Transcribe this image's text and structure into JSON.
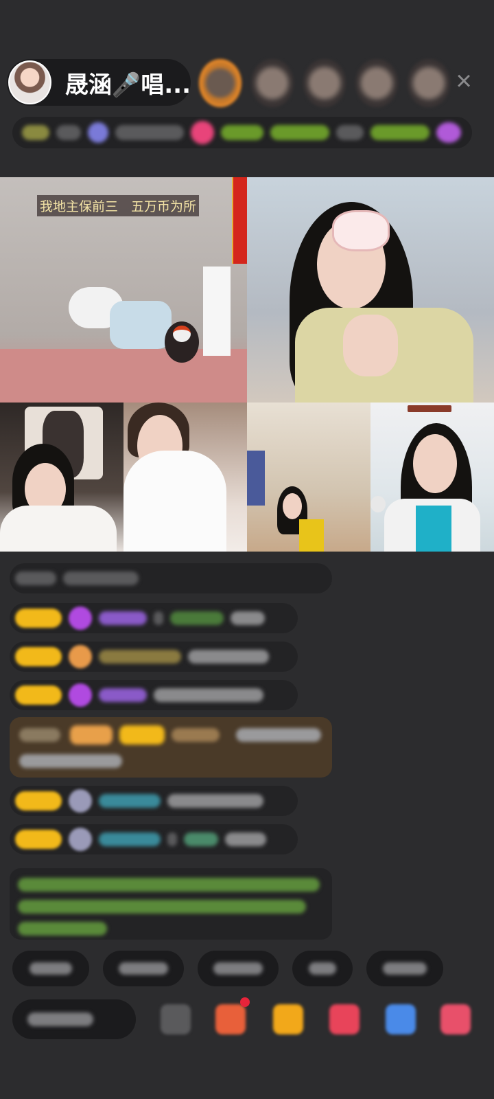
{
  "header": {
    "host_name": "晟涵🎤唱...",
    "close_symbol": "×"
  },
  "video": {
    "tile_a_caption": "我地主保前三　五万币为所"
  },
  "colors": {
    "background": "#2c2c2e",
    "accent_orange": "#e88a2a",
    "badge_yellow": "#f2b91a",
    "notice_green": "#8ac84a",
    "system_brown": "#4a3a28"
  },
  "icons": {
    "close": "close-icon",
    "gift": "gift-icon",
    "more": "more-icon"
  }
}
